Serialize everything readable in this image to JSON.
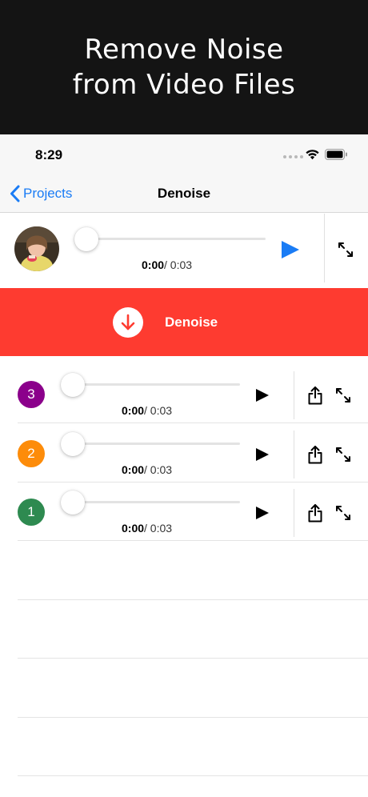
{
  "banner": {
    "line1": "Remove Noise",
    "line2": "from Video Files"
  },
  "status_bar": {
    "time": "8:29",
    "wifi_icon": "wifi-icon",
    "battery_icon": "battery-icon"
  },
  "nav": {
    "back_label": "Projects",
    "title": "Denoise",
    "back_icon": "chevron-left-icon"
  },
  "source": {
    "current_time": "0:00",
    "duration": "/ 0:03",
    "progress": 0,
    "play_icon": "play-icon",
    "expand_icon": "expand-icon"
  },
  "denoise": {
    "label": "Denoise",
    "icon": "arrow-down-icon"
  },
  "results": [
    {
      "number": "3",
      "color": "#8b008b",
      "current_time": "0:00",
      "duration": "/ 0:03",
      "progress": 0
    },
    {
      "number": "2",
      "color": "#fd8c0a",
      "current_time": "0:00",
      "duration": "/ 0:03",
      "progress": 0
    },
    {
      "number": "1",
      "color": "#2e8a50",
      "current_time": "0:00",
      "duration": "/ 0:03",
      "progress": 0
    }
  ],
  "colors": {
    "accent": "#1a7cf5",
    "denoise_bar": "#fe3b30",
    "banner_bg": "#141414"
  }
}
